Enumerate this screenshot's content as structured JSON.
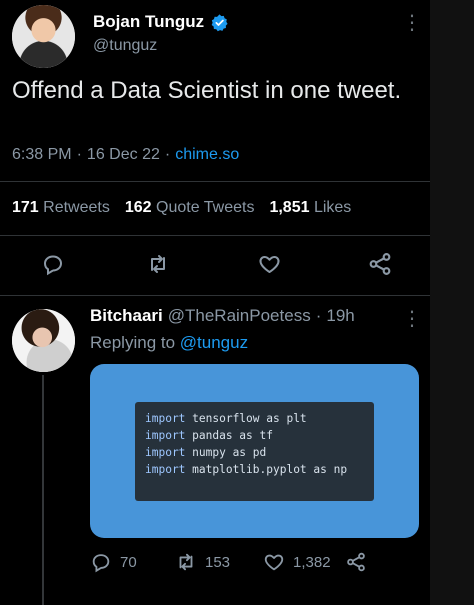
{
  "tweet": {
    "author_name": "Bojan Tunguz",
    "author_handle": "@tunguz",
    "text": "Offend a Data Scientist in one tweet.",
    "time": "6:38 PM",
    "date": "16 Dec 22",
    "source": "chime.so",
    "retweets_count": "171",
    "retweets_label": "Retweets",
    "quotes_count": "162",
    "quotes_label": "Quote Tweets",
    "likes_count": "1,851",
    "likes_label": "Likes",
    "more_glyph": "⋮",
    "sep": "·"
  },
  "reply": {
    "author_name": "Bitchaari",
    "author_handle": "@TheRainPoetess",
    "age": "19h",
    "replying_prefix": "Replying to",
    "replying_handle": "@tunguz",
    "code_lines": [
      {
        "kw": "import",
        "rest": " tensorflow as plt"
      },
      {
        "kw": "import",
        "rest": " pandas as tf"
      },
      {
        "kw": "import",
        "rest": " numpy as pd"
      },
      {
        "kw": "import",
        "rest": " matplotlib.pyplot as np"
      }
    ],
    "replies_count": "70",
    "retweets_count": "153",
    "likes_count": "1,382",
    "more_glyph": "⋮",
    "sep": "·"
  },
  "colors": {
    "accent": "#1d9bf0",
    "code_card": "#4895d9",
    "code_bg": "#26313b"
  },
  "icons": {
    "verified": "verified-badge-icon",
    "reply": "reply-icon",
    "retweet": "retweet-icon",
    "like": "heart-icon",
    "share": "share-icon"
  }
}
